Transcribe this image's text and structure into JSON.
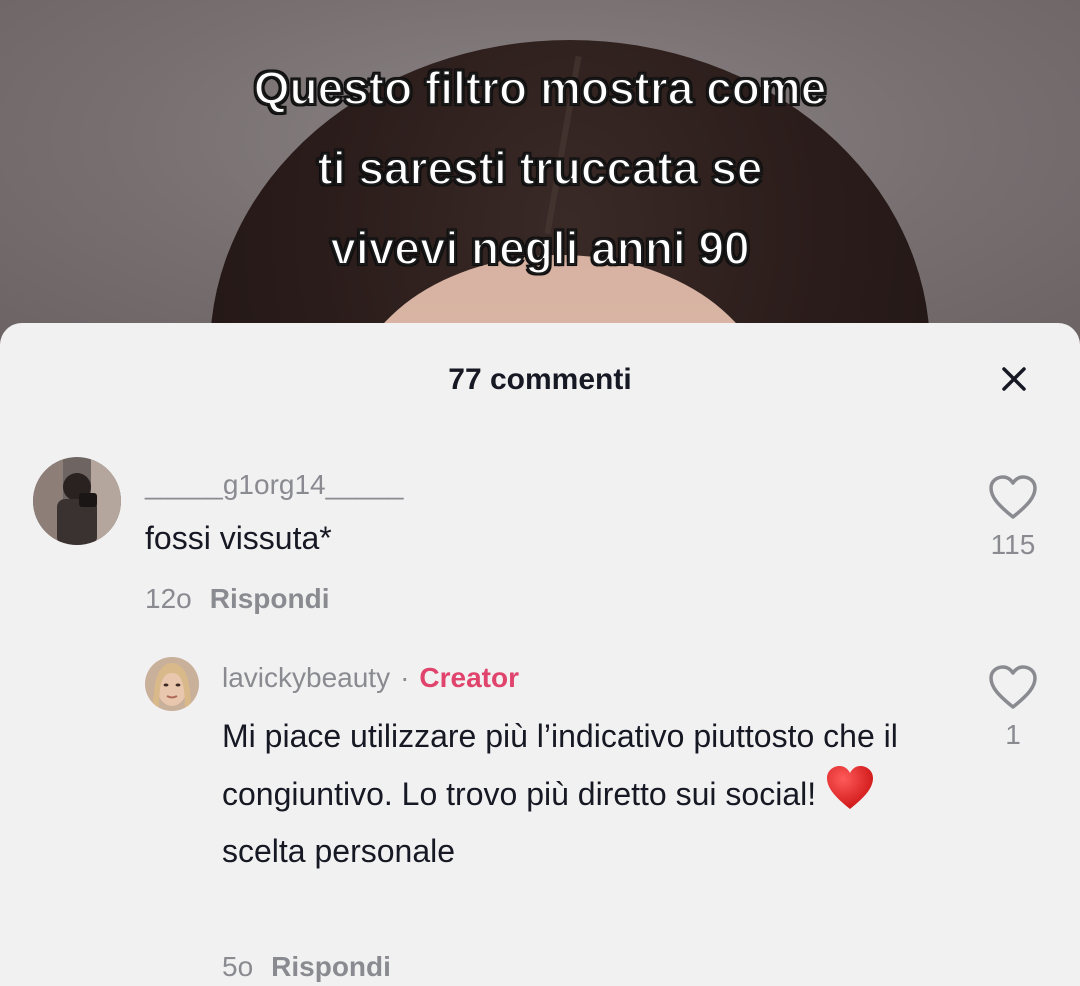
{
  "video": {
    "caption_lines": [
      "Questo filtro mostra come",
      "ti saresti truccata se",
      "vivevi negli anni 90"
    ]
  },
  "sheet": {
    "title": "77 commenti",
    "close_icon": "close-icon"
  },
  "comments": [
    {
      "username": "_____g1org14_____",
      "text": "fossi vissuta*",
      "time": "12o",
      "reply_label": "Rispondi",
      "likes": "115"
    },
    {
      "username": "lavickybeauty",
      "separator": "·",
      "badge": "Creator",
      "text_before_emoji": "Mi piace utilizzare più l’indicativo piuttosto che il congiuntivo. Lo trovo più diretto sui social! ",
      "emoji": "red-heart-emoji",
      "text_after_emoji": "scelta personale",
      "time": "5o",
      "reply_label": "Rispondi",
      "likes": "1"
    }
  ],
  "colors": {
    "sheet_bg": "#f2f1f2",
    "text_primary": "#161823",
    "text_secondary": "#8a8b91",
    "creator_badge": "#e0436b"
  }
}
